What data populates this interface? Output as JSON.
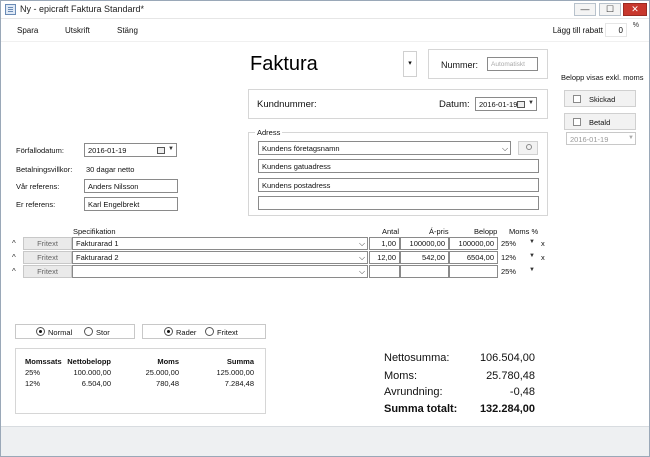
{
  "window": {
    "title": "Ny - epicraft Faktura Standard*",
    "minimize": "—",
    "maximize": "☐",
    "close": "✕"
  },
  "menu": {
    "spara": "Spara",
    "utskrift": "Utskrift",
    "stang": "Stäng",
    "discount_label": "Lägg till rabatt",
    "discount_value": "0",
    "discount_unit": "%"
  },
  "header": {
    "doc_type": "Faktura",
    "nummer_label": "Nummer:",
    "nummer_placeholder": "Automatiskt"
  },
  "customer": {
    "kundnummer_label": "Kundnummer:",
    "datum_label": "Datum:",
    "datum_value": "2016-01-19"
  },
  "address": {
    "label": "Adress",
    "company": "Kundens företagsnamn",
    "street": "Kundens gatuadress",
    "postal": "Kundens postadress",
    "extra": ""
  },
  "details": {
    "forfallodatum_label": "Förfallodatum:",
    "forfallodatum_value": "2016-01-19",
    "betalningsvillkor_label": "Betalningsvillkor:",
    "betalningsvillkor_value": "30 dagar netto",
    "var_referens_label": "Vår referens:",
    "var_referens_value": "Anders Nilsson",
    "er_referens_label": "Er referens:",
    "er_referens_value": "Karl Engelbrekt"
  },
  "side": {
    "belopp_note": "Belopp visas exkl. moms",
    "skickad": "Skickad",
    "betald": "Betald",
    "betald_date": "2016-01-19"
  },
  "grid": {
    "columns": {
      "spec": "Specifikation",
      "antal": "Antal",
      "apris": "Á-pris",
      "belopp": "Belopp",
      "moms": "Moms %"
    },
    "fritext_label": "Fritext",
    "rows": [
      {
        "spec": "Fakturarad 1",
        "antal": "1,00",
        "apris": "100000,00",
        "belopp": "100000,00",
        "moms": "25%",
        "remove": "x"
      },
      {
        "spec": "Fakturarad 2",
        "antal": "12,00",
        "apris": "542,00",
        "belopp": "6504,00",
        "moms": "12%",
        "remove": "x"
      },
      {
        "spec": "",
        "antal": "",
        "apris": "",
        "belopp": "",
        "moms": "25%",
        "remove": ""
      }
    ]
  },
  "options": {
    "normal": "Normal",
    "stor": "Stor",
    "rader": "Rader",
    "fritext": "Fritext"
  },
  "moms_table": {
    "headers": [
      "Momssats",
      "Nettobelopp",
      "Moms",
      "Summa"
    ],
    "rows": [
      [
        "25%",
        "100.000,00",
        "25.000,00",
        "125.000,00"
      ],
      [
        "12%",
        "6.504,00",
        "780,48",
        "7.284,48"
      ]
    ]
  },
  "totals": {
    "netto_label": "Nettosumma:",
    "netto_value": "106.504,00",
    "moms_label": "Moms:",
    "moms_value": "25.780,48",
    "avrundning_label": "Avrundning:",
    "avrundning_value": "-0,48",
    "summa_label": "Summa totalt:",
    "summa_value": "132.284,00"
  }
}
